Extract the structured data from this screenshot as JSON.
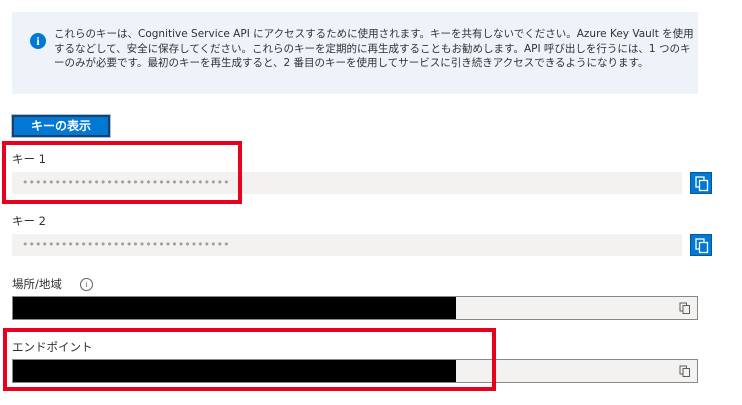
{
  "info": {
    "text": "これらのキーは、Cognitive Service API にアクセスするために使用されます。キーを共有しないでください。Azure Key Vault を使用するなどして、安全に保存してください。これらのキーを定期的に再生成することもお勧めします。API 呼び出しを行うには、1 つのキーのみが必要です。最初のキーを再生成すると、2 番目のキーを使用してサービスに引き続きアクセスできるようになります。"
  },
  "show_keys_label": "キーの表示",
  "key1": {
    "label": "キー 1",
    "masked_value": "••••••••••••••••••••••••••••••••"
  },
  "key2": {
    "label": "キー 2",
    "masked_value": "••••••••••••••••••••••••••••••••"
  },
  "location": {
    "label": "場所/地域"
  },
  "endpoint": {
    "label": "エンドポイント"
  },
  "colors": {
    "accent": "#0078d4",
    "highlight": "#e8001c",
    "redaction": "#000000"
  }
}
